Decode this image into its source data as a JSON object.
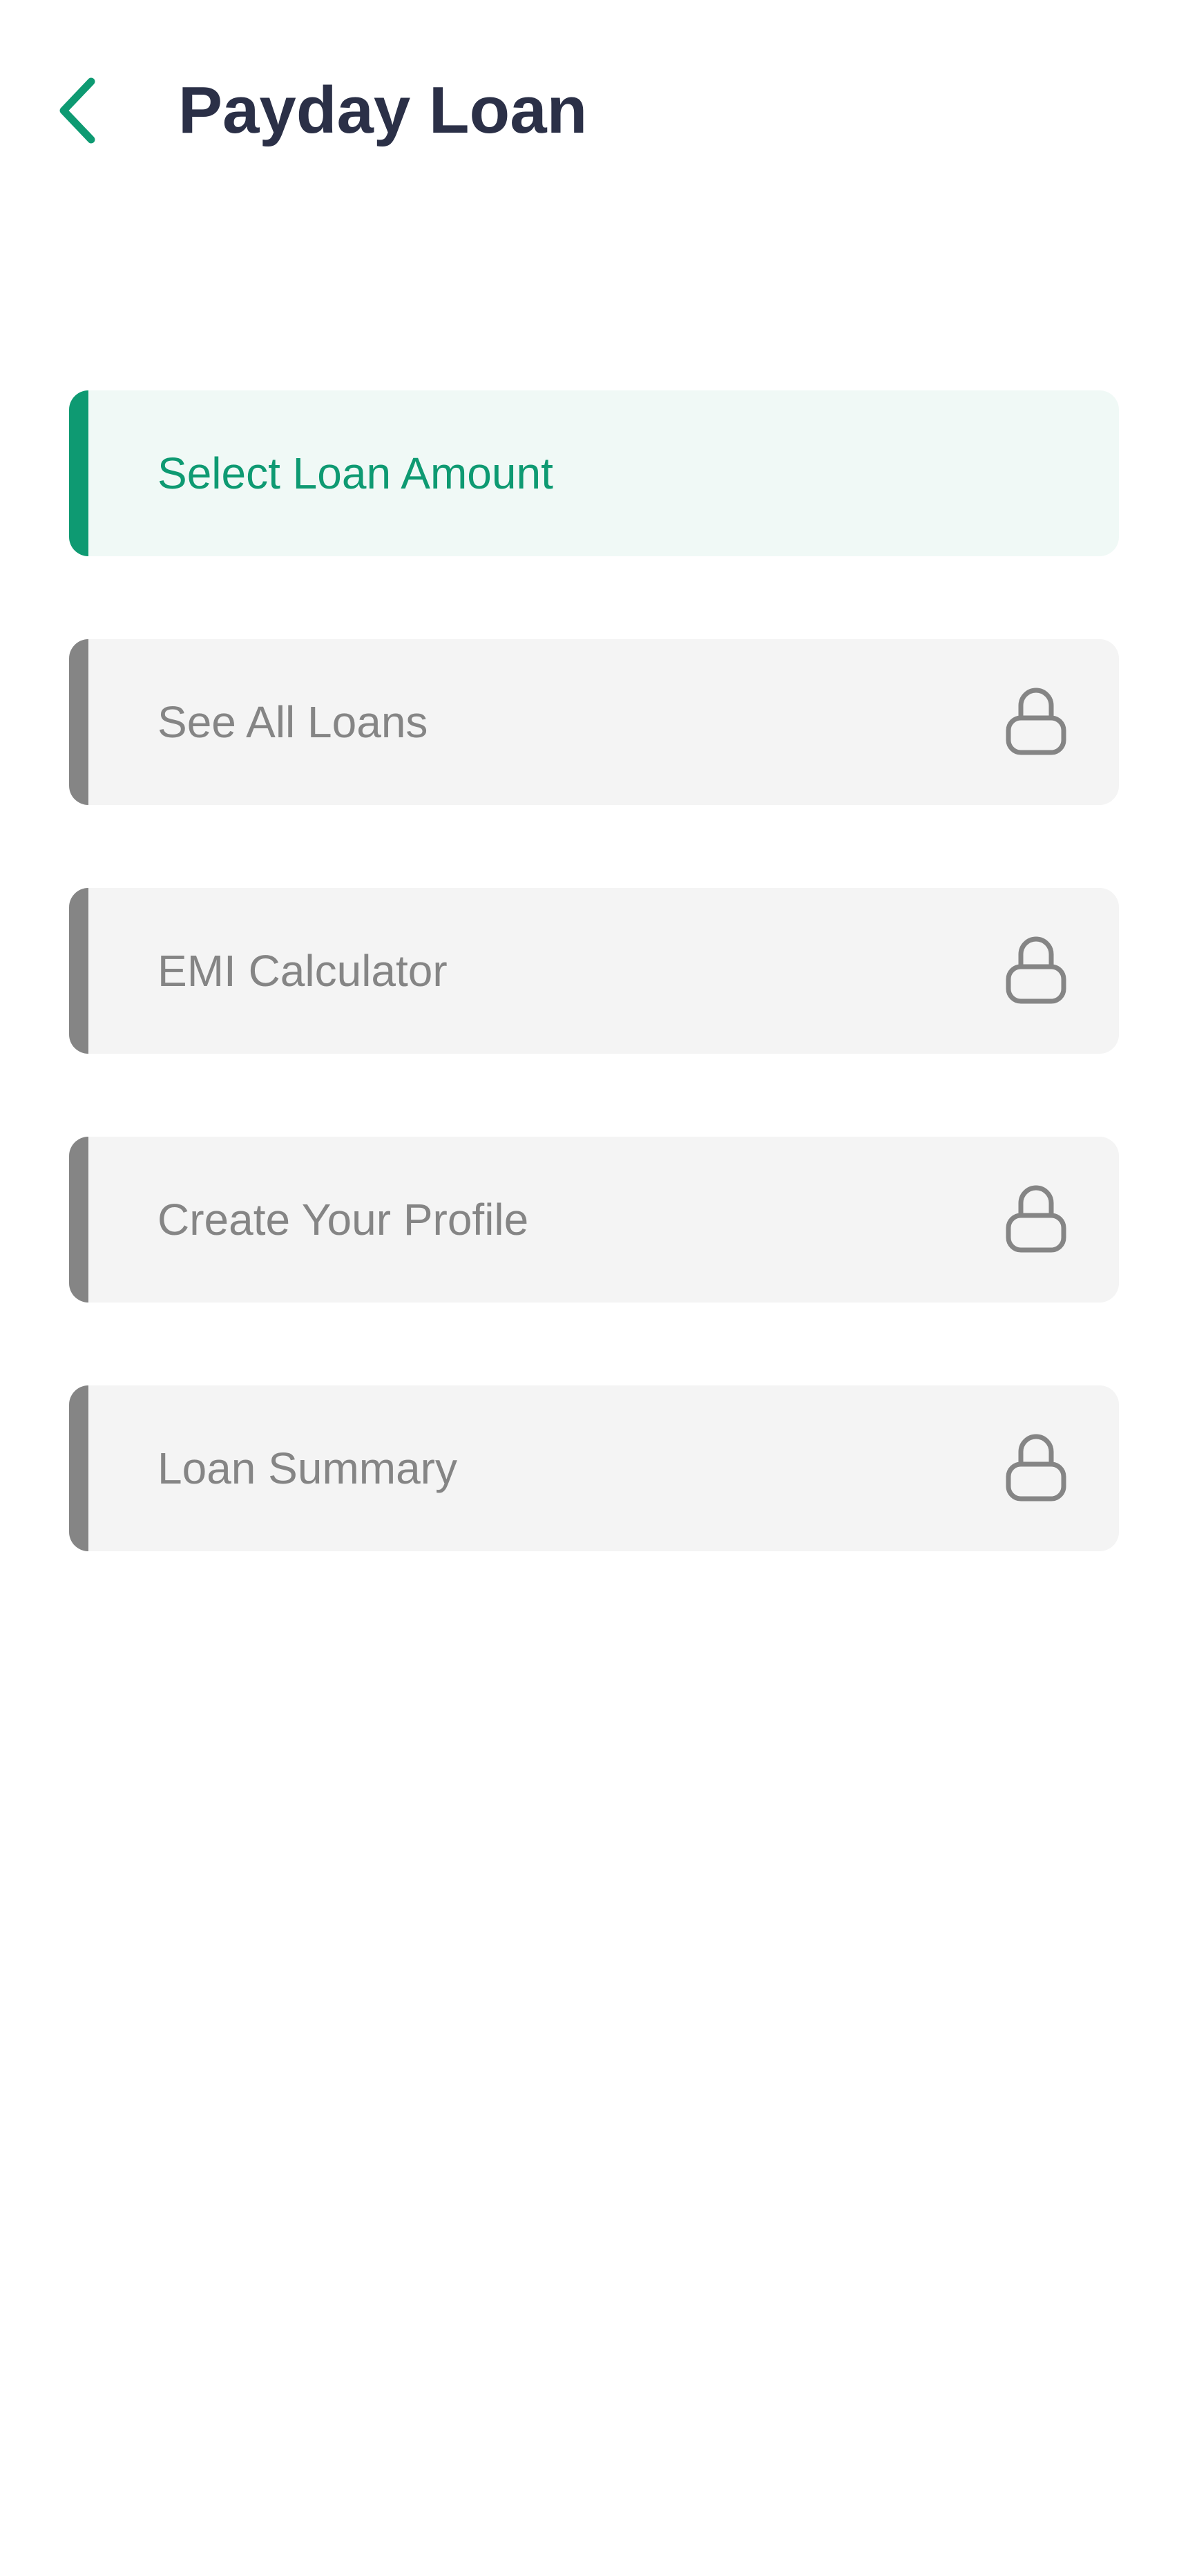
{
  "header": {
    "title": "Payday Loan",
    "back_icon": "chevron-left-icon"
  },
  "colors": {
    "accent": "#0e9a72",
    "active_bg": "#f0f9f6",
    "inactive_text": "#858585",
    "inactive_bg": "#f4f4f4",
    "title": "#2b3047"
  },
  "steps": [
    {
      "label": "Select Loan Amount",
      "state": "active"
    },
    {
      "label": "See All Loans",
      "state": "locked",
      "icon": "lock-icon"
    },
    {
      "label": "EMI Calculator",
      "state": "locked",
      "icon": "lock-icon"
    },
    {
      "label": "Create Your Profile",
      "state": "locked",
      "icon": "lock-icon"
    },
    {
      "label": "Loan Summary",
      "state": "locked",
      "icon": "lock-icon"
    }
  ]
}
